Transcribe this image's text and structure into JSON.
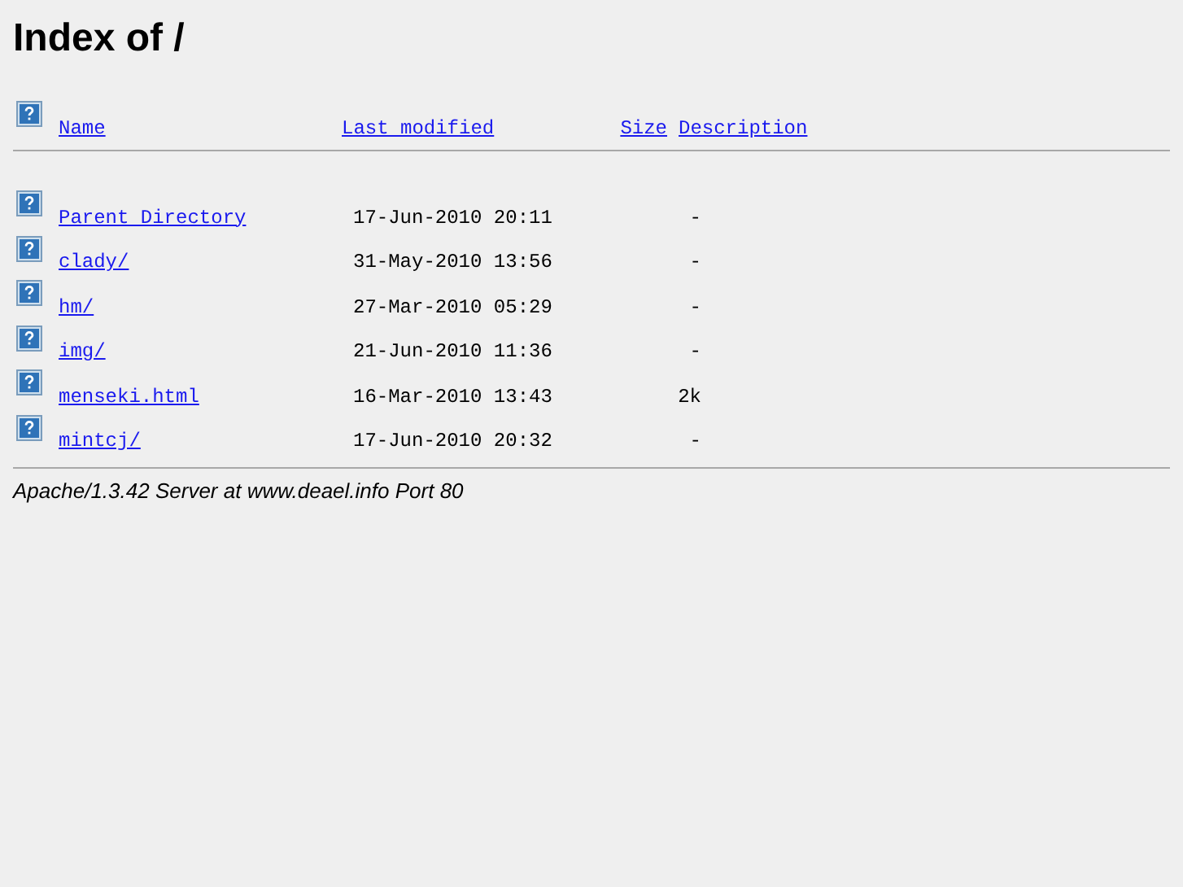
{
  "title": "Index of /",
  "columns": [
    {
      "label": "Name"
    },
    {
      "label": "Last modified"
    },
    {
      "label": "Size"
    },
    {
      "label": "Description"
    }
  ],
  "rows": [
    {
      "name": "Parent Directory",
      "modified": "17-Jun-2010 20:11",
      "size": "-"
    },
    {
      "name": "clady/",
      "modified": "31-May-2010 13:56",
      "size": "-"
    },
    {
      "name": "hm/",
      "modified": "27-Mar-2010 05:29",
      "size": "-"
    },
    {
      "name": "img/",
      "modified": "21-Jun-2010 11:36",
      "size": "-"
    },
    {
      "name": "menseki.html",
      "modified": "16-Mar-2010 13:43",
      "size": "2k"
    },
    {
      "name": "mintcj/",
      "modified": "17-Jun-2010 20:32",
      "size": "-"
    }
  ],
  "footer": "Apache/1.3.42 Server at www.deael.info Port 80"
}
